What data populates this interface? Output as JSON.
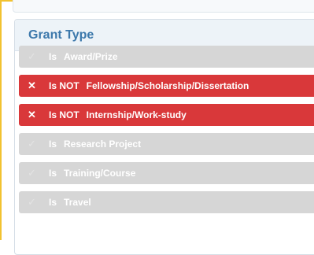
{
  "panel": {
    "title": "Grant Type"
  },
  "icons": {
    "check": "✓",
    "cross": "✕"
  },
  "filters": [
    {
      "op": "Is",
      "label": "Award/Prize",
      "state": "inactive"
    },
    {
      "op": "Is NOT",
      "label": "Fellowship/Scholarship/Dissertation",
      "state": "excluded"
    },
    {
      "op": "Is NOT",
      "label": "Internship/Work-study",
      "state": "excluded"
    },
    {
      "op": "Is",
      "label": "Research Project",
      "state": "inactive"
    },
    {
      "op": "Is",
      "label": "Training/Course",
      "state": "inactive"
    },
    {
      "op": "Is",
      "label": "Travel",
      "state": "inactive"
    }
  ],
  "colors": {
    "excluded": "#d9383a",
    "inactive": "#d6d6d6",
    "title": "#3c78ab",
    "frame": "#f2c230"
  }
}
